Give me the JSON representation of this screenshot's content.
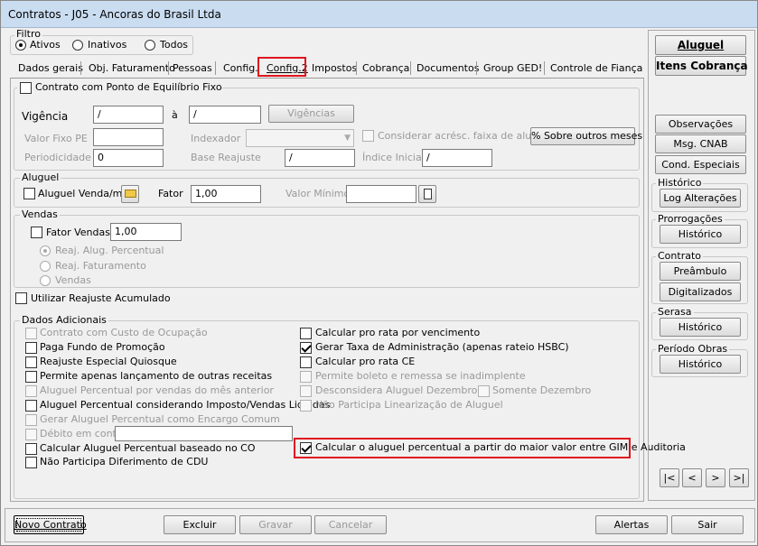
{
  "window": {
    "title": "Contratos - J05 - Ancoras do Brasil Ltda"
  },
  "filtro": {
    "label": "Filtro",
    "options": [
      "Ativos",
      "Inativos",
      "Todos"
    ]
  },
  "tabs": [
    "Dados gerais",
    "Obj. Faturamento",
    "Pessoas",
    "Config.",
    "Config.2",
    "Impostos",
    "Cobrança",
    "Documentos",
    "Group GED!",
    "Controle de Fiança"
  ],
  "equilibrio": {
    "label": "Contrato com Ponto de Equilíbrio Fixo",
    "vigencia_label": "Vigência",
    "vig_from": "/",
    "a_label": "à",
    "vig_to": "/",
    "vigencias_btn": "Vigências",
    "valor_fixo_label": "Valor Fixo PE",
    "indexador_label": "Indexador",
    "considerar_label": "Considerar acrésc. faixa de aluguel",
    "sobre_btn": "% Sobre outros meses",
    "periodicidade_label": "Periodicidade",
    "periodicidade_value": "0",
    "base_label": "Base Reajuste",
    "base_value": "/",
    "indice_label": "Índice Inicial",
    "indice_value": "/"
  },
  "aluguel": {
    "label": "Aluguel",
    "venda_label": "Aluguel Venda/m²",
    "fator_label": "Fator",
    "fator_value": "1,00",
    "valor_min_label": "Valor Mínimo"
  },
  "vendas": {
    "label": "Vendas",
    "fator_label": "Fator Vendas",
    "fator_value": "1,00",
    "opt1": "Reaj. Alug. Percentual",
    "opt2": "Reaj. Faturamento",
    "opt3": "Vendas"
  },
  "reajuste_acum": "Utilizar Reajuste Acumulado",
  "dados": {
    "label": "Dados Adicionais",
    "left": [
      "Contrato com Custo de Ocupação",
      "Paga Fundo de Promoção",
      "Reajuste Especial Quiosque",
      "Permite apenas lançamento de outras receitas",
      "Aluguel Percentual por vendas do mês anterior",
      "Aluguel Percentual considerando Imposto/Vendas Liquidas",
      "Gerar Aluguel Percentual como Encargo Comum",
      "Débito em conta",
      "Calcular Aluguel Percentual baseado no CO",
      "Não Participa Diferimento de CDU"
    ],
    "right": [
      "Calcular pro rata por vencimento",
      "Gerar Taxa de Administração (apenas rateio HSBC)",
      "Calcular pro rata CE",
      "Permite boleto e remessa se inadimplente",
      "Desconsidera Aluguel Dezembro",
      "Não Participa Linearização de Aluguel",
      "Calcular o aluguel percentual a partir do maior valor entre GIM e Auditoria"
    ],
    "somente": "Somente Dezembro"
  },
  "side": {
    "aluguel": "Aluguel",
    "itens": "Itens Cobrança",
    "observacoes": "Observações",
    "msg": "Msg. CNAB",
    "cond": "Cond. Especiais",
    "historico_g": "Histórico",
    "log": "Log Alterações",
    "prorrog_g": "Prorrogações",
    "hist": "Histórico",
    "contrato_g": "Contrato",
    "preambulo": "Preâmbulo",
    "digitalizados": "Digitalizados",
    "serasa_g": "Serasa",
    "periodo_g": "Período Obras",
    "nav": [
      "|<",
      "<",
      ">",
      ">|"
    ]
  },
  "footer": {
    "novo": "Novo Contrato",
    "excluir": "Excluir",
    "gravar": "Gravar",
    "cancelar": "Cancelar",
    "alertas": "Alertas",
    "sair": "Sair"
  }
}
